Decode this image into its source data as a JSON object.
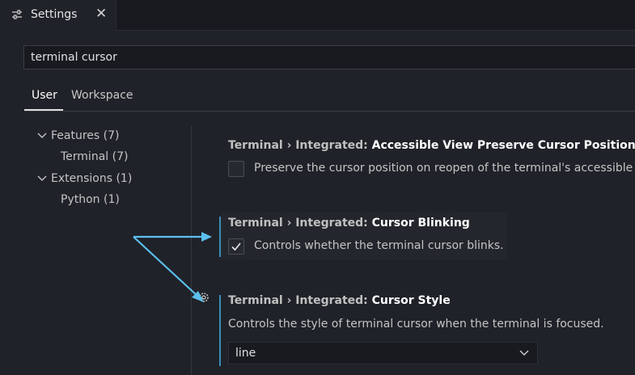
{
  "tab": {
    "title": "Settings",
    "close_glyph": "✕",
    "icon": "settings-sliders-icon"
  },
  "search": {
    "value": "terminal cursor"
  },
  "scopes": {
    "user": "User",
    "workspace": "Workspace"
  },
  "toc": [
    {
      "label": "Features (7)",
      "expanded": true
    },
    {
      "label": "Terminal (7)"
    },
    {
      "label": "Extensions (1)",
      "expanded": true
    },
    {
      "label": "Python (1)"
    }
  ],
  "settings": [
    {
      "category": "Terminal › Integrated: ",
      "name": "Accessible View Preserve Cursor Position",
      "description": "Preserve the cursor position on reopen of the terminal's accessible vi",
      "checked": false
    },
    {
      "category": "Terminal › Integrated: ",
      "name": "Cursor Blinking",
      "description": "Controls whether the terminal cursor blinks.",
      "checked": true
    },
    {
      "category": "Terminal › Integrated: ",
      "name": "Cursor Style",
      "description": "Controls the style of terminal cursor when the terminal is focused.",
      "value": "line"
    }
  ],
  "colors": {
    "accent_bar": "#3a8fb7",
    "arrow": "#5cc0ee",
    "background": "#1f2228"
  }
}
